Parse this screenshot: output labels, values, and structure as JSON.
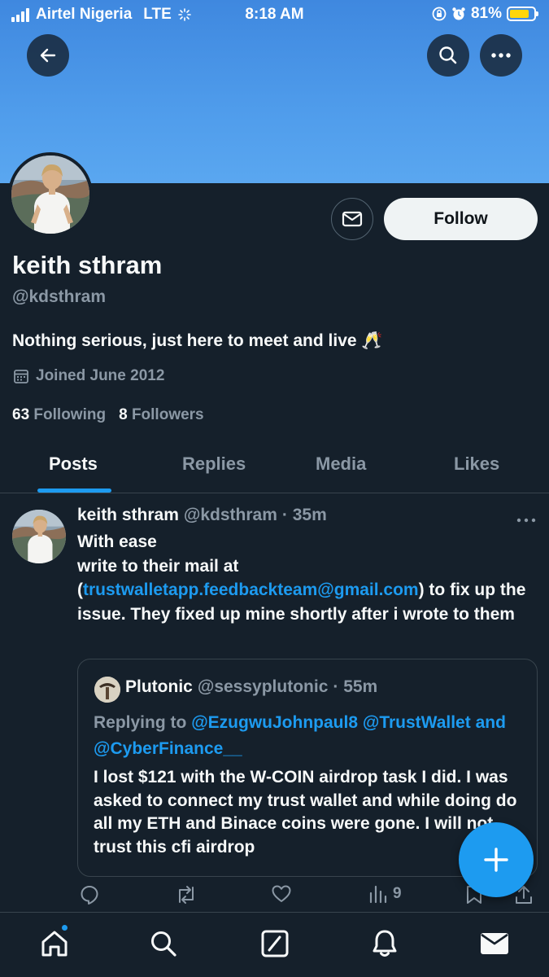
{
  "status_bar": {
    "carrier": "Airtel Nigeria",
    "network": "LTE",
    "time": "8:18 AM",
    "battery": "81%",
    "battery_level": 0.81
  },
  "header": {
    "back_icon": "arrow-left-icon",
    "search_icon": "search-icon",
    "more_icon": "more-dots-icon"
  },
  "profile": {
    "name": "keith sthram",
    "handle": "@kdsthram",
    "bio": "Nothing serious, just here to meet and live 🥂",
    "joined": "Joined June 2012",
    "following_count": "63",
    "following_label": "Following",
    "followers_count": "8",
    "followers_label": "Followers",
    "follow_label": "Follow"
  },
  "tabs": [
    {
      "label": "Posts",
      "active": true
    },
    {
      "label": "Replies",
      "active": false
    },
    {
      "label": "Media",
      "active": false
    },
    {
      "label": "Likes",
      "active": false
    }
  ],
  "post": {
    "author": "keith sthram",
    "handle": "@kdsthram",
    "time": "· 35m",
    "line1": "With ease",
    "line2": "write to their mail at",
    "open_paren": "(",
    "email": "trustwalletapp.feedbackteam@gmail.com",
    "after_email": ") to fix up the issue. They fixed up mine shortly after i wrote to them",
    "quoted": {
      "author": "Plutonic",
      "handle": "@sessyplutonic",
      "time": "· 55m",
      "replying_to": "Replying to",
      "mention1": "@EzugwuJohnpaul8",
      "mention2": "@TrustWallet",
      "and": "and",
      "mention3": "@CyberFinance__",
      "text": "I lost $121 with the W-COIN airdrop task I did. I was asked to connect my trust wallet and while doing do all my ETH and Binace coins were gone. I will not trust this cfi airdrop"
    },
    "views": "9"
  },
  "colors": {
    "accent": "#1d9bf0",
    "background": "#15202b",
    "banner": "#4f9ceb"
  }
}
